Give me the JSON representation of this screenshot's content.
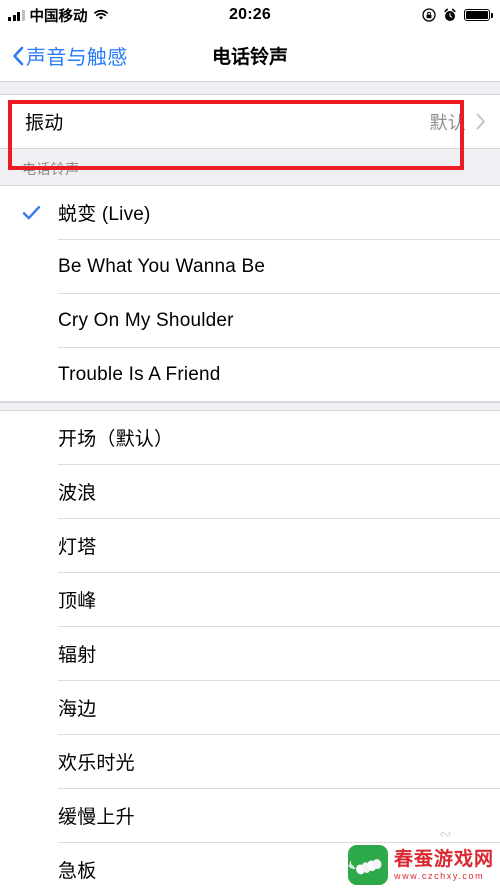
{
  "status_bar": {
    "carrier": "中国移动",
    "time": "20:26",
    "signal_icon": "signal-bars-icon",
    "wifi_icon": "wifi-icon",
    "rotation_lock_icon": "rotation-lock-icon",
    "alarm_icon": "alarm-clock-icon",
    "battery_icon": "battery-icon"
  },
  "nav": {
    "back_label": "声音与触感",
    "back_icon": "chevron-left-icon",
    "title": "电话铃声"
  },
  "vibration": {
    "label": "振动",
    "value": "默认",
    "disclosure_icon": "chevron-right-icon"
  },
  "section": {
    "header": "电话铃声"
  },
  "tones_custom": [
    {
      "label": "蜕变 (Live)",
      "selected": true
    },
    {
      "label": "Be What You Wanna Be",
      "selected": false
    },
    {
      "label": "Cry On My Shoulder",
      "selected": false
    },
    {
      "label": "Trouble Is A Friend",
      "selected": false
    }
  ],
  "tones_builtin": [
    {
      "label": "开场（默认）",
      "selected": false
    },
    {
      "label": "波浪",
      "selected": false
    },
    {
      "label": "灯塔",
      "selected": false
    },
    {
      "label": "顶峰",
      "selected": false
    },
    {
      "label": "辐射",
      "selected": false
    },
    {
      "label": "海边",
      "selected": false
    },
    {
      "label": "欢乐时光",
      "selected": false
    },
    {
      "label": "缓慢上升",
      "selected": false
    },
    {
      "label": "急板",
      "selected": false
    }
  ],
  "colors": {
    "accent": "#007AFF",
    "nav_blue": "#2A7DF5",
    "highlight_red": "#EF1B24",
    "group_bg": "#EFEFF4",
    "separator": "#DCDCDF",
    "secondary_text": "#8E8E93"
  },
  "highlight": {
    "target": "振动"
  },
  "watermark": {
    "title": "春蚕游戏网",
    "url": "www.czchxy.com",
    "logo_icon": "silkworm-logo-icon"
  }
}
